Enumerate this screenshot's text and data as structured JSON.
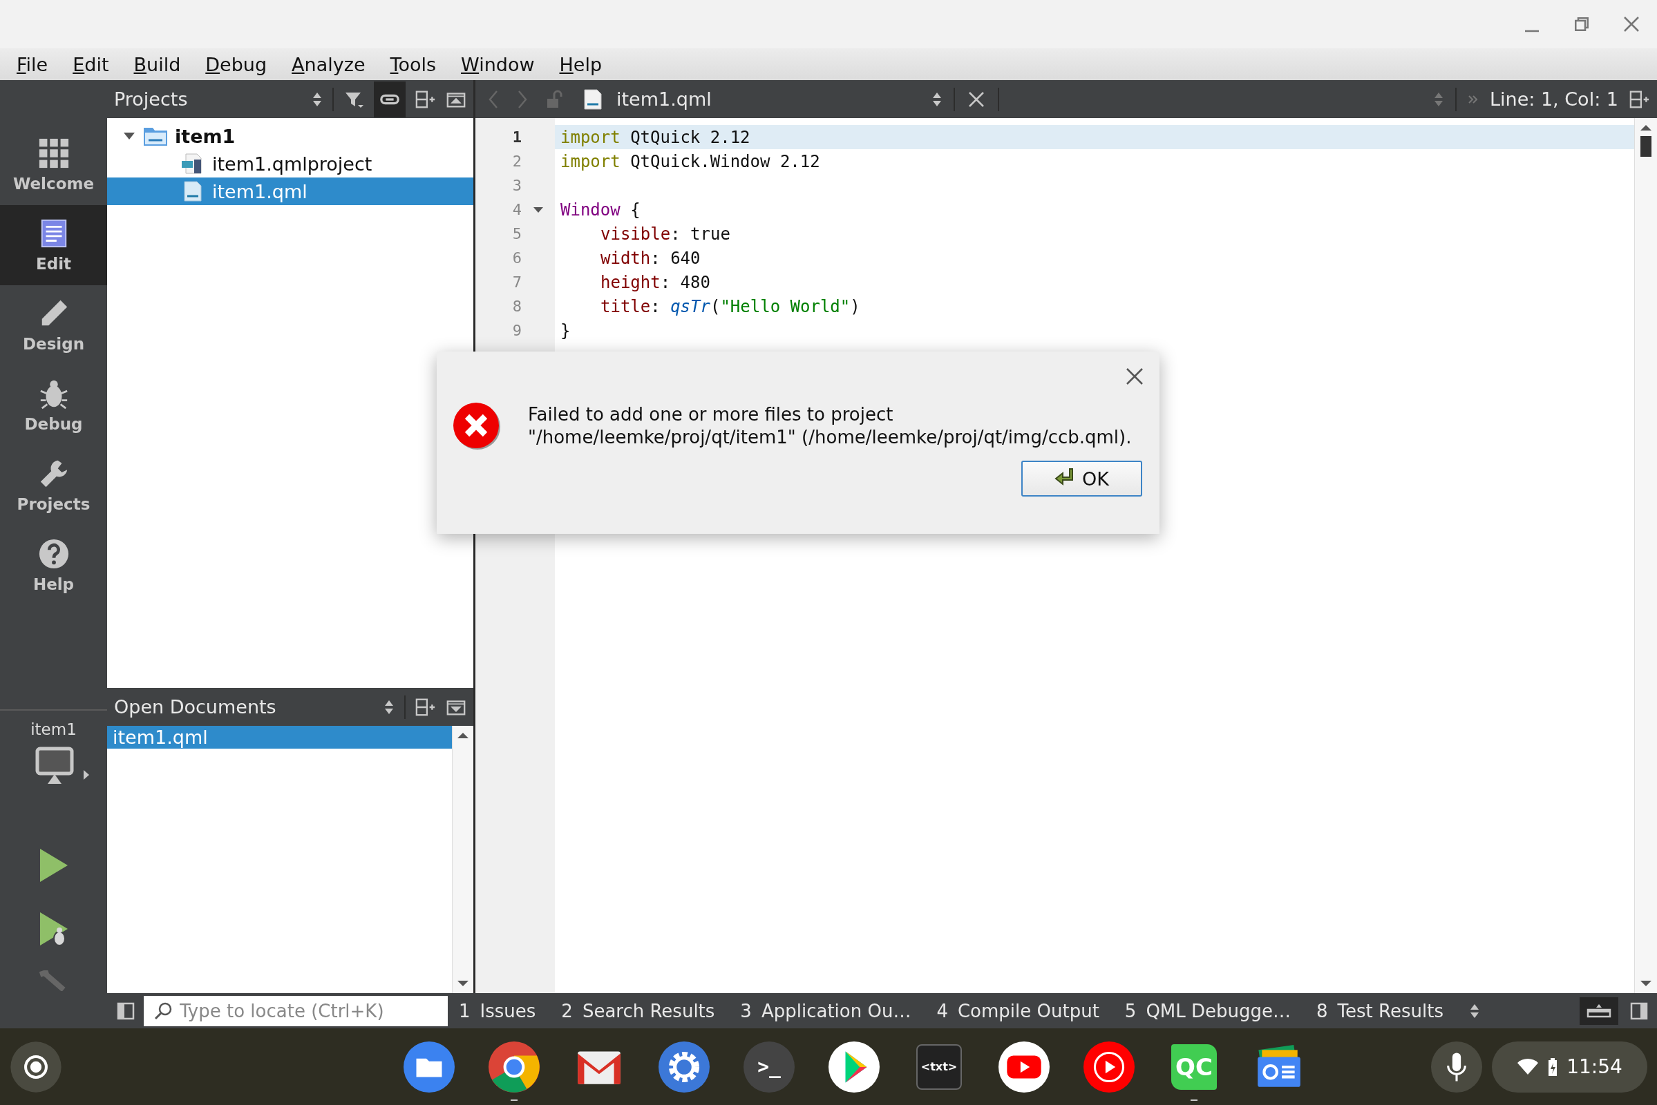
{
  "menu": [
    "File",
    "Edit",
    "Build",
    "Debug",
    "Analyze",
    "Tools",
    "Window",
    "Help"
  ],
  "modes": [
    {
      "label": "Welcome",
      "selected": false
    },
    {
      "label": "Edit",
      "selected": true
    },
    {
      "label": "Design",
      "selected": false
    },
    {
      "label": "Debug",
      "selected": false
    },
    {
      "label": "Projects",
      "selected": false
    },
    {
      "label": "Help",
      "selected": false
    }
  ],
  "target": {
    "name": "item1"
  },
  "projects": {
    "title": "Projects",
    "tree": [
      {
        "label": "item1",
        "kind": "folder",
        "expanded": true,
        "selected": false,
        "children": [
          {
            "label": "item1.qmlproject",
            "kind": "qmlproject",
            "selected": false
          },
          {
            "label": "item1.qml",
            "kind": "qml",
            "selected": true
          }
        ]
      }
    ]
  },
  "open_documents": {
    "title": "Open Documents",
    "items": [
      {
        "label": "item1.qml",
        "selected": true
      }
    ]
  },
  "editor": {
    "tab": "item1.qml",
    "position": "Line: 1, Col: 1",
    "lines": [
      {
        "number": "1",
        "current": true,
        "indented": false,
        "tokens": [
          {
            "kind": "keyword",
            "text": "import"
          },
          {
            "kind": "plain",
            "text": " QtQuick 2.12"
          }
        ]
      },
      {
        "number": "2",
        "current": false,
        "indented": false,
        "tokens": [
          {
            "kind": "keyword",
            "text": "import"
          },
          {
            "kind": "plain",
            "text": " QtQuick.Window 2.12"
          }
        ]
      },
      {
        "number": "3",
        "current": false
      },
      {
        "number": "4",
        "current": false,
        "expanded": true,
        "indented": false,
        "tokens": [
          {
            "kind": "type",
            "text": "Window"
          },
          {
            "kind": "plain",
            "text": " {"
          }
        ]
      },
      {
        "number": "5",
        "current": false,
        "indented": true,
        "tokens": [
          {
            "kind": "property",
            "text": "visible"
          },
          {
            "kind": "plain",
            "text": ": true"
          }
        ]
      },
      {
        "number": "6",
        "current": false,
        "indented": true,
        "tokens": [
          {
            "kind": "property",
            "text": "width"
          },
          {
            "kind": "plain",
            "text": ": 640"
          }
        ]
      },
      {
        "number": "7",
        "current": false,
        "indented": true,
        "tokens": [
          {
            "kind": "property",
            "text": "height"
          },
          {
            "kind": "plain",
            "text": ": 480"
          }
        ]
      },
      {
        "number": "8",
        "current": false,
        "indented": true,
        "tokens": [
          {
            "kind": "property",
            "text": "title"
          },
          {
            "kind": "plain",
            "text": ": "
          },
          {
            "kind": "function",
            "text": "qsTr"
          },
          {
            "kind": "plain",
            "text": "("
          },
          {
            "kind": "string",
            "text": "\"Hello World\""
          },
          {
            "kind": "plain",
            "text": ")"
          }
        ]
      },
      {
        "number": "9",
        "current": false,
        "indented": false,
        "tokens": [
          {
            "kind": "plain",
            "text": "}"
          }
        ]
      }
    ]
  },
  "dialog": {
    "message_lines": [
      "Failed to add one or more files to project",
      "\"/home/leemke/proj/qt/item1\" (/home/leemke/proj/qt/img/ccb.qml)."
    ],
    "button": "OK"
  },
  "output_bar": {
    "locate_placeholder": "Type to locate (Ctrl+K)",
    "tabs": [
      {
        "number": "1",
        "label": "Issues"
      },
      {
        "number": "2",
        "label": "Search Results"
      },
      {
        "number": "3",
        "label": "Application Ou…"
      },
      {
        "number": "4",
        "label": "Compile Output"
      },
      {
        "number": "5",
        "label": "QML Debugge…"
      },
      {
        "number": "8",
        "label": "Test Results"
      }
    ]
  },
  "taskbar": {
    "apps": [
      {
        "kind": "files",
        "running": false
      },
      {
        "kind": "chrome",
        "running": true
      },
      {
        "kind": "gmail",
        "running": false
      },
      {
        "kind": "settings",
        "running": false
      },
      {
        "kind": "terminal",
        "text": ">_",
        "running": false
      },
      {
        "kind": "play",
        "running": false
      },
      {
        "kind": "txt",
        "text": "<txt>",
        "running": false
      },
      {
        "kind": "youtube",
        "running": false
      },
      {
        "kind": "ytmusic",
        "running": false
      },
      {
        "kind": "qc",
        "text": "QC",
        "running": true
      },
      {
        "kind": "news",
        "running": false
      }
    ],
    "time": "11:54"
  }
}
